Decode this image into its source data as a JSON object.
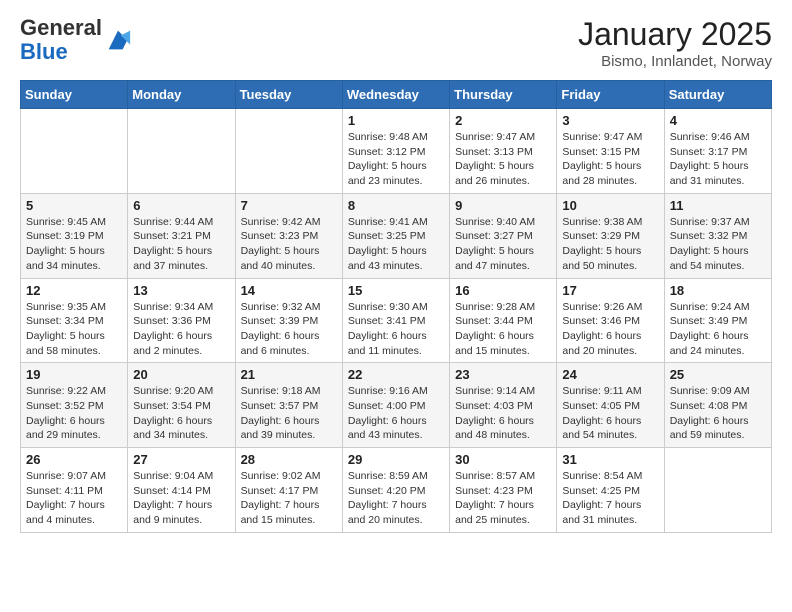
{
  "logo": {
    "text_general": "General",
    "text_blue": "Blue"
  },
  "title": "January 2025",
  "subtitle": "Bismo, Innlandet, Norway",
  "days_of_week": [
    "Sunday",
    "Monday",
    "Tuesday",
    "Wednesday",
    "Thursday",
    "Friday",
    "Saturday"
  ],
  "weeks": [
    [
      {
        "day": "",
        "info": ""
      },
      {
        "day": "",
        "info": ""
      },
      {
        "day": "",
        "info": ""
      },
      {
        "day": "1",
        "info": "Sunrise: 9:48 AM\nSunset: 3:12 PM\nDaylight: 5 hours and 23 minutes."
      },
      {
        "day": "2",
        "info": "Sunrise: 9:47 AM\nSunset: 3:13 PM\nDaylight: 5 hours and 26 minutes."
      },
      {
        "day": "3",
        "info": "Sunrise: 9:47 AM\nSunset: 3:15 PM\nDaylight: 5 hours and 28 minutes."
      },
      {
        "day": "4",
        "info": "Sunrise: 9:46 AM\nSunset: 3:17 PM\nDaylight: 5 hours and 31 minutes."
      }
    ],
    [
      {
        "day": "5",
        "info": "Sunrise: 9:45 AM\nSunset: 3:19 PM\nDaylight: 5 hours and 34 minutes."
      },
      {
        "day": "6",
        "info": "Sunrise: 9:44 AM\nSunset: 3:21 PM\nDaylight: 5 hours and 37 minutes."
      },
      {
        "day": "7",
        "info": "Sunrise: 9:42 AM\nSunset: 3:23 PM\nDaylight: 5 hours and 40 minutes."
      },
      {
        "day": "8",
        "info": "Sunrise: 9:41 AM\nSunset: 3:25 PM\nDaylight: 5 hours and 43 minutes."
      },
      {
        "day": "9",
        "info": "Sunrise: 9:40 AM\nSunset: 3:27 PM\nDaylight: 5 hours and 47 minutes."
      },
      {
        "day": "10",
        "info": "Sunrise: 9:38 AM\nSunset: 3:29 PM\nDaylight: 5 hours and 50 minutes."
      },
      {
        "day": "11",
        "info": "Sunrise: 9:37 AM\nSunset: 3:32 PM\nDaylight: 5 hours and 54 minutes."
      }
    ],
    [
      {
        "day": "12",
        "info": "Sunrise: 9:35 AM\nSunset: 3:34 PM\nDaylight: 5 hours and 58 minutes."
      },
      {
        "day": "13",
        "info": "Sunrise: 9:34 AM\nSunset: 3:36 PM\nDaylight: 6 hours and 2 minutes."
      },
      {
        "day": "14",
        "info": "Sunrise: 9:32 AM\nSunset: 3:39 PM\nDaylight: 6 hours and 6 minutes."
      },
      {
        "day": "15",
        "info": "Sunrise: 9:30 AM\nSunset: 3:41 PM\nDaylight: 6 hours and 11 minutes."
      },
      {
        "day": "16",
        "info": "Sunrise: 9:28 AM\nSunset: 3:44 PM\nDaylight: 6 hours and 15 minutes."
      },
      {
        "day": "17",
        "info": "Sunrise: 9:26 AM\nSunset: 3:46 PM\nDaylight: 6 hours and 20 minutes."
      },
      {
        "day": "18",
        "info": "Sunrise: 9:24 AM\nSunset: 3:49 PM\nDaylight: 6 hours and 24 minutes."
      }
    ],
    [
      {
        "day": "19",
        "info": "Sunrise: 9:22 AM\nSunset: 3:52 PM\nDaylight: 6 hours and 29 minutes."
      },
      {
        "day": "20",
        "info": "Sunrise: 9:20 AM\nSunset: 3:54 PM\nDaylight: 6 hours and 34 minutes."
      },
      {
        "day": "21",
        "info": "Sunrise: 9:18 AM\nSunset: 3:57 PM\nDaylight: 6 hours and 39 minutes."
      },
      {
        "day": "22",
        "info": "Sunrise: 9:16 AM\nSunset: 4:00 PM\nDaylight: 6 hours and 43 minutes."
      },
      {
        "day": "23",
        "info": "Sunrise: 9:14 AM\nSunset: 4:03 PM\nDaylight: 6 hours and 48 minutes."
      },
      {
        "day": "24",
        "info": "Sunrise: 9:11 AM\nSunset: 4:05 PM\nDaylight: 6 hours and 54 minutes."
      },
      {
        "day": "25",
        "info": "Sunrise: 9:09 AM\nSunset: 4:08 PM\nDaylight: 6 hours and 59 minutes."
      }
    ],
    [
      {
        "day": "26",
        "info": "Sunrise: 9:07 AM\nSunset: 4:11 PM\nDaylight: 7 hours and 4 minutes."
      },
      {
        "day": "27",
        "info": "Sunrise: 9:04 AM\nSunset: 4:14 PM\nDaylight: 7 hours and 9 minutes."
      },
      {
        "day": "28",
        "info": "Sunrise: 9:02 AM\nSunset: 4:17 PM\nDaylight: 7 hours and 15 minutes."
      },
      {
        "day": "29",
        "info": "Sunrise: 8:59 AM\nSunset: 4:20 PM\nDaylight: 7 hours and 20 minutes."
      },
      {
        "day": "30",
        "info": "Sunrise: 8:57 AM\nSunset: 4:23 PM\nDaylight: 7 hours and 25 minutes."
      },
      {
        "day": "31",
        "info": "Sunrise: 8:54 AM\nSunset: 4:25 PM\nDaylight: 7 hours and 31 minutes."
      },
      {
        "day": "",
        "info": ""
      }
    ]
  ]
}
